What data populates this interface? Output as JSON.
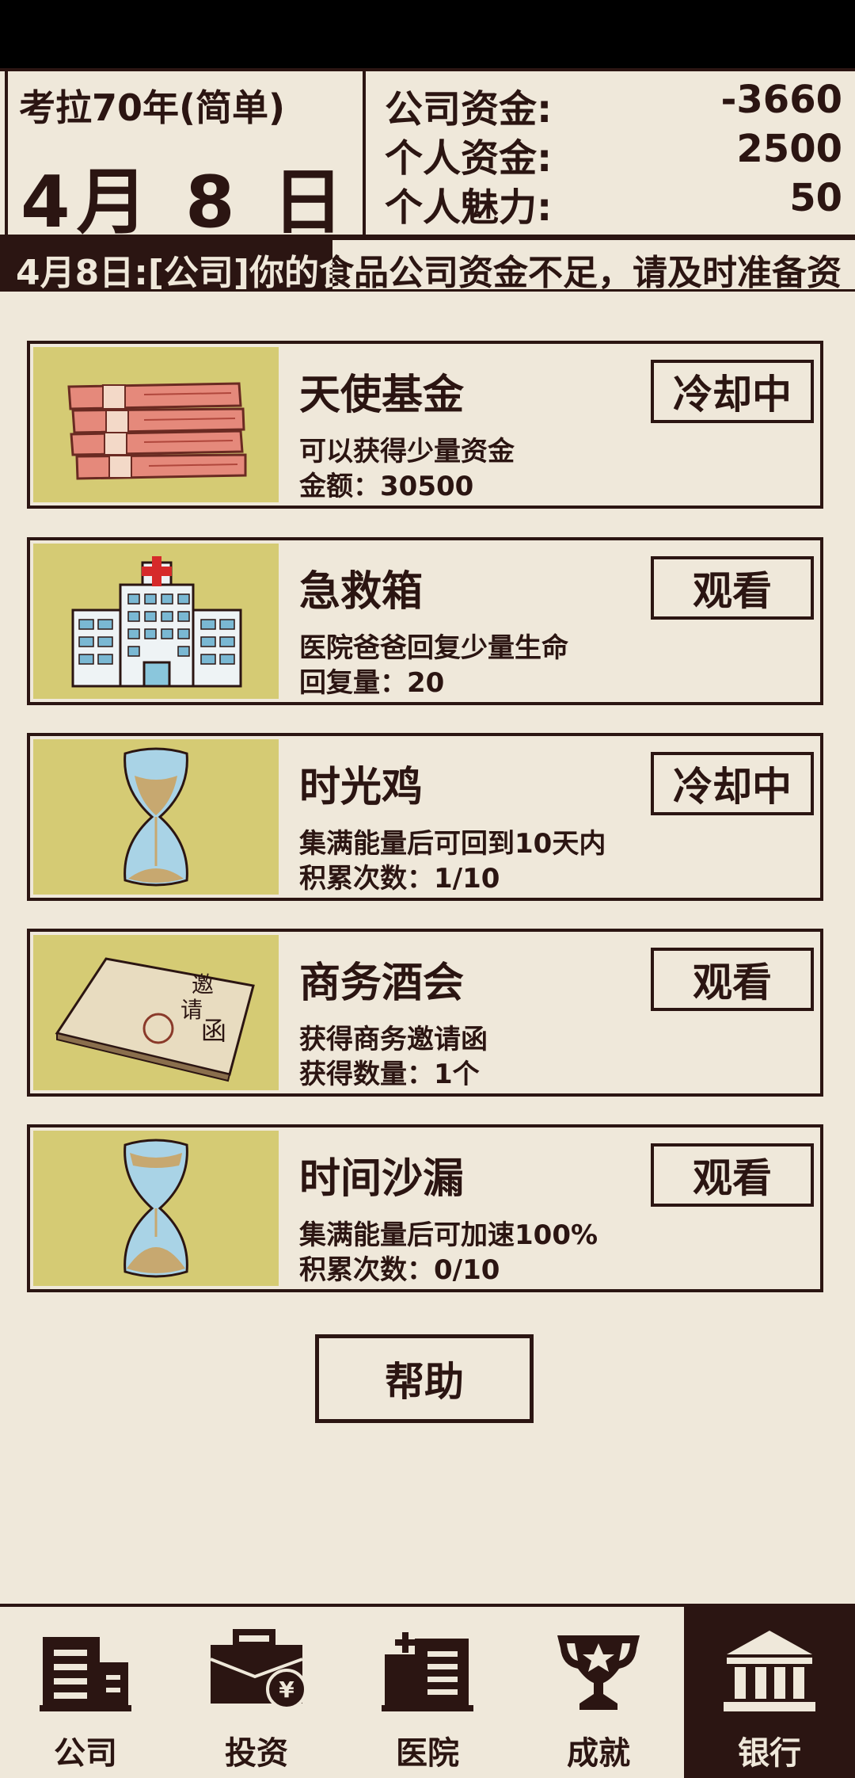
{
  "header": {
    "game_mode": "考拉70年(简单)",
    "date": "4月 8 日",
    "stats": [
      {
        "label": "公司资金:",
        "value": "-3660"
      },
      {
        "label": "个人资金:",
        "value": "2500"
      },
      {
        "label": "个人魅力:",
        "value": "50"
      }
    ]
  },
  "ticker": {
    "text": "4月8日:[公司]你的食品公司资金不足，请及时准备资"
  },
  "cards": [
    {
      "title": "天使基金",
      "desc": "可以获得少量资金",
      "sub": "金额：30500",
      "button": "冷却中",
      "icon": "money-stack-icon"
    },
    {
      "title": "急救箱",
      "desc": "医院爸爸回复少量生命",
      "sub": "回复量：20",
      "button": "观看",
      "icon": "hospital-icon"
    },
    {
      "title": "时光鸡",
      "desc": "集满能量后可回到10天内",
      "sub": "积累次数：1/10",
      "button": "冷却中",
      "icon": "hourglass-icon"
    },
    {
      "title": "商务酒会",
      "desc": "获得商务邀请函",
      "sub": "获得数量：1个",
      "button": "观看",
      "icon": "invitation-card-icon"
    },
    {
      "title": "时间沙漏",
      "desc": "集满能量后可加速100%",
      "sub": "积累次数：0/10",
      "button": "观看",
      "icon": "hourglass-icon"
    }
  ],
  "help_button": "帮助",
  "invitation_art_text": "邀请函",
  "nav": [
    {
      "label": "公司",
      "icon": "company-building-icon"
    },
    {
      "label": "投资",
      "icon": "briefcase-yen-icon"
    },
    {
      "label": "医院",
      "icon": "hospital-building-icon"
    },
    {
      "label": "成就",
      "icon": "trophy-icon"
    },
    {
      "label": "银行",
      "icon": "bank-icon",
      "active": true
    }
  ],
  "colors": {
    "background": "#efe8da",
    "ink": "#2b1512",
    "card_image_bg": "#d5cb74"
  }
}
